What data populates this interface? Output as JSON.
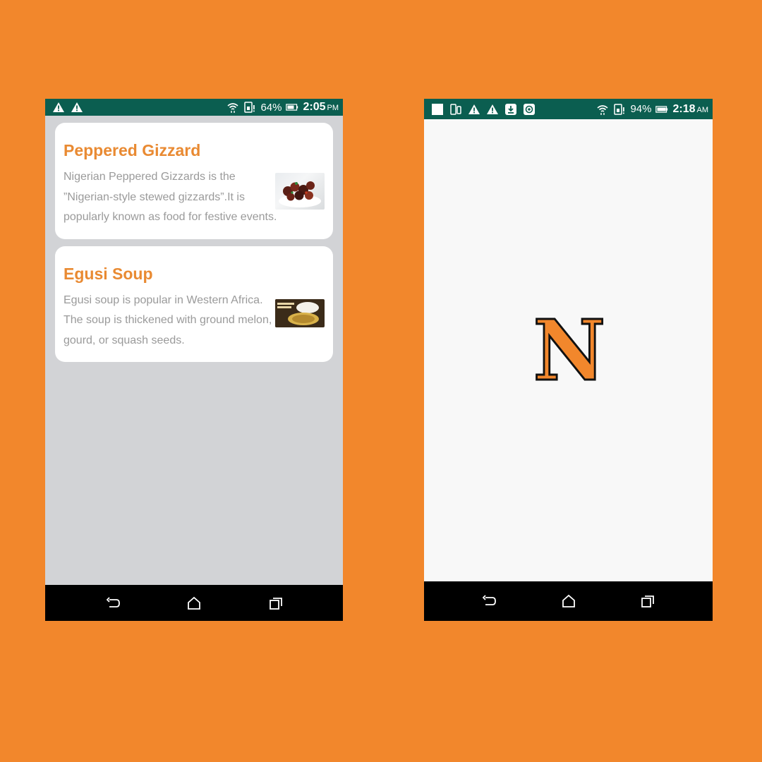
{
  "left_screen": {
    "status_bar": {
      "battery_percent": "64%",
      "time": "2:05",
      "ampm": "PM",
      "icons": [
        "warning-icon",
        "warning-icon",
        "wifi-icon",
        "sim-icon",
        "battery-icon"
      ]
    },
    "recipes": [
      {
        "title": "Peppered Gizzard",
        "description": "Nigerian Peppered Gizzards is the ”Nigerian-style stewed gizzards”.It is popularly known as food for festive events.",
        "thumbnail": "peppered-gizzard-photo"
      },
      {
        "title": "Egusi Soup",
        "description": "Egusi soup is popular in Western Africa. The soup is thickened with ground melon, gourd, or squash seeds.",
        "thumbnail": "egusi-soup-photo"
      }
    ],
    "nav_bar": {
      "buttons": [
        "back-icon",
        "home-icon",
        "recents-icon"
      ]
    }
  },
  "right_screen": {
    "status_bar": {
      "battery_percent": "94%",
      "time": "2:18",
      "ampm": "AM",
      "icons": [
        "notification-square-icon",
        "phone-rotate-icon",
        "warning-icon",
        "warning-icon",
        "download-icon",
        "email-icon",
        "wifi-icon",
        "sim-icon",
        "battery-icon"
      ]
    },
    "splash": {
      "logo_letter": "N"
    },
    "nav_bar": {
      "buttons": [
        "back-icon",
        "home-icon",
        "recents-icon"
      ]
    }
  },
  "colors": {
    "background": "#F2872C",
    "status_bar": "#0B5E50",
    "accent": "#E98A32",
    "list_background": "#D2D3D6",
    "text_secondary": "#9A9A9A"
  }
}
